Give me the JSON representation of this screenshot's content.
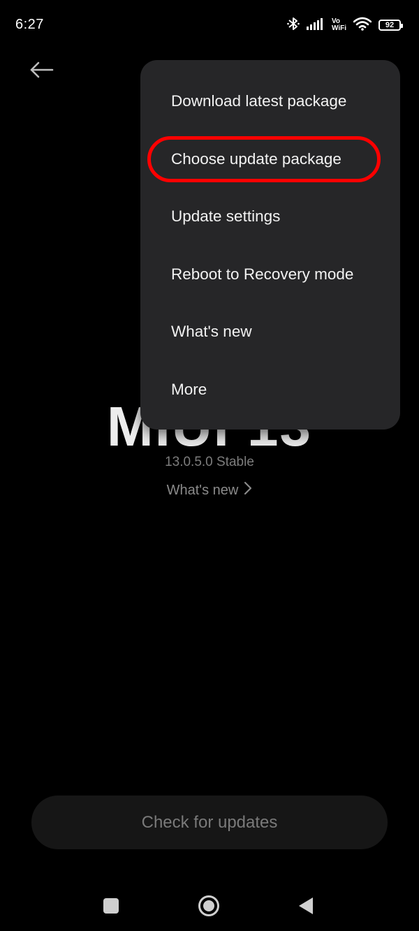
{
  "status_bar": {
    "time": "6:27",
    "vowifi_top": "Vo",
    "vowifi_bottom": "WiFi",
    "battery": "92"
  },
  "header": {
    "back_icon": "arrow-left-icon"
  },
  "background": {
    "logo": "MIUI 13",
    "version": "13.0.5.0 Stable",
    "whats_new": "What's new"
  },
  "menu": {
    "items": [
      {
        "label": "Download latest package"
      },
      {
        "label": "Choose update package"
      },
      {
        "label": "Update settings"
      },
      {
        "label": "Reboot to Recovery mode"
      },
      {
        "label": "What's new"
      },
      {
        "label": "More"
      }
    ],
    "highlighted_index": 1,
    "highlight_color": "#ff0000"
  },
  "footer": {
    "check_button": "Check for updates"
  },
  "nav_bar": {
    "icons": [
      "recents-square-icon",
      "home-circle-icon",
      "back-triangle-icon"
    ]
  }
}
